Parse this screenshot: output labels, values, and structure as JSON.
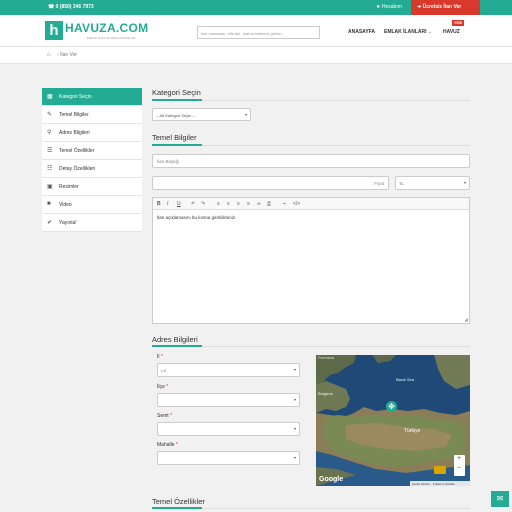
{
  "topbar": {
    "phone": "0 (850) 346 7973",
    "account": "Hesabım",
    "free_ad": "Ücretsiz İlan Ver"
  },
  "header": {
    "logo_mark": "h",
    "logo_name": "HAVUZA.COM",
    "logo_tag": "EMLAK İLAN VE KİRALIK İLANLAR",
    "search_placeholder": "İlan numarası, ofis adı, arama kelimesi giriniz...",
    "nav": {
      "home": "ANASAYFA",
      "categories": "EMLAK İLANLARI",
      "news": "HAVUZ",
      "new_badge": "YENİ"
    }
  },
  "breadcrumb": {
    "current": "İlan Ver"
  },
  "sidebar": {
    "items": [
      {
        "label": "Kategori Seçin",
        "icon": "grid-icon"
      },
      {
        "label": "Temel Bilgiler",
        "icon": "edit-icon"
      },
      {
        "label": "Adres Bilgileri",
        "icon": "map-marker-icon"
      },
      {
        "label": "Temel Özellikler",
        "icon": "list-icon"
      },
      {
        "label": "Detay Özellikleri",
        "icon": "list-detail-icon"
      },
      {
        "label": "Resimler",
        "icon": "image-icon"
      },
      {
        "label": "Video",
        "icon": "video-icon"
      },
      {
        "label": "Yayınla!",
        "icon": "check-icon"
      }
    ]
  },
  "category": {
    "title": "Kategori Seçin",
    "select_value": "-- Alt Kategori Seçin --"
  },
  "basic": {
    "title": "Temel Bilgiler",
    "ad_title_placeholder": "İlan Başlığı",
    "price_placeholder": "Fiyat",
    "currency_value": "TL",
    "editor_placeholder": "İlan açıklamasını bu kısma girebilirsiniz.",
    "toolbar": [
      "B",
      "I",
      "U",
      "↶",
      "↷",
      "≡",
      "≡",
      "≡",
      "≡",
      "∞",
      "⎙",
      "⌁",
      "</>"
    ]
  },
  "address": {
    "title": "Adres Bilgileri",
    "il_label": "İl",
    "il_value": "• İl",
    "ilce_label": "İlçe",
    "semt_label": "Semt",
    "mahalle_label": "Mahalle",
    "required_mark": "*",
    "map": {
      "labels": [
        "Romania",
        "Black Sea",
        "Bulgaria",
        "Türkiye"
      ],
      "provider": "Google",
      "footer": [
        "Harita Verileri",
        "Kullanım Şartları"
      ],
      "zoom_in": "+",
      "zoom_out": "−"
    }
  },
  "features": {
    "title": "Temel Özellikler"
  },
  "float_button": {
    "icon": "mail-icon"
  },
  "colors": {
    "accent": "#24ab93",
    "danger": "#d9382c"
  }
}
